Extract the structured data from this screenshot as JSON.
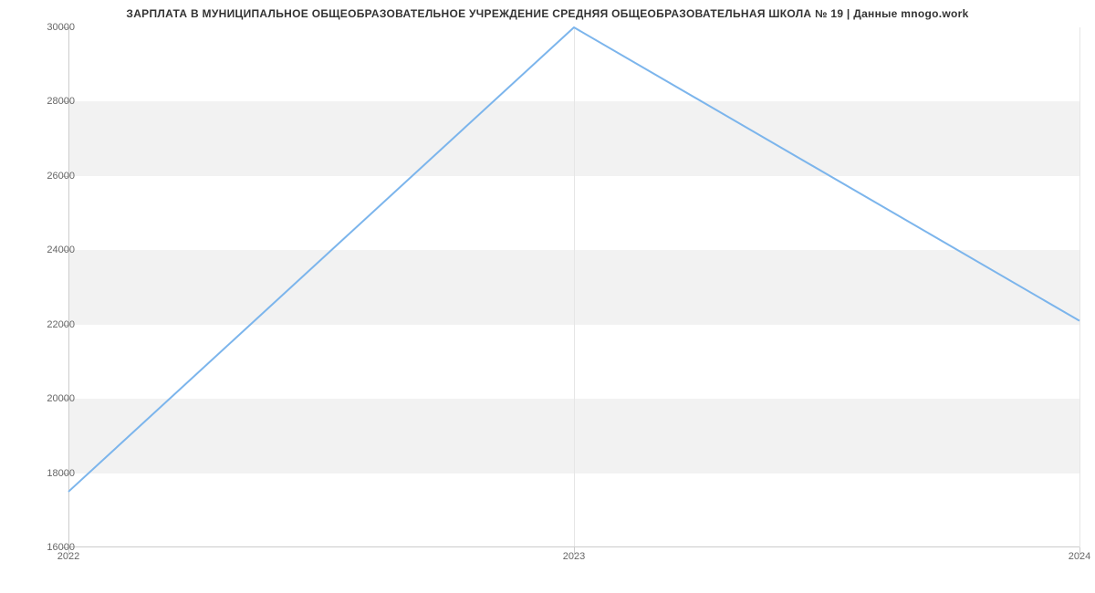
{
  "chart_data": {
    "type": "line",
    "title": "ЗАРПЛАТА В МУНИЦИПАЛЬНОЕ ОБЩЕОБРАЗОВАТЕЛЬНОЕ УЧРЕЖДЕНИЕ СРЕДНЯЯ ОБЩЕОБРАЗОВАТЕЛЬНАЯ ШКОЛА № 19 | Данные mnogo.work",
    "x": [
      2022,
      2023,
      2024
    ],
    "values": [
      17500,
      30000,
      22100
    ],
    "xlabel": "",
    "ylabel": "",
    "xlim": [
      2022,
      2024
    ],
    "ylim": [
      16000,
      30000
    ],
    "y_ticks": [
      16000,
      18000,
      20000,
      22000,
      24000,
      26000,
      28000,
      30000
    ],
    "x_ticks": [
      2022,
      2023,
      2024
    ],
    "line_color": "#7cb5ec",
    "band_color": "#f2f2f2"
  }
}
